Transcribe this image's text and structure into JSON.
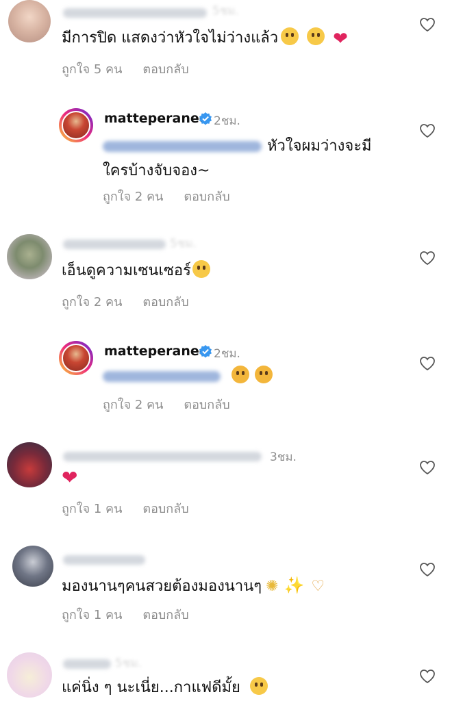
{
  "actions": {
    "like": "ถูกใจ",
    "reply": "ตอบกลับ"
  },
  "comments": [
    {
      "user_label": "nunnnnnnnuch_alt",
      "time": "5ชม.",
      "text": "มีการปิด แสดงว่าหัวใจไม่ว่างแล้ว",
      "emojis": [
        "pleading-face-emoji",
        "crying-face-emoji",
        "red-heart-emoji"
      ],
      "likes": "ถูกใจ 5 คน",
      "reply": "ตอบกลับ"
    },
    {
      "user": "matteperanee",
      "time": "2ชม.",
      "mention_label": "@nunnnnnnnuch_alt",
      "text_line1": "หัวใจผมว่างจะมี",
      "text_line2": "ใครบ้างจับจอง~",
      "likes": "ถูกใจ 2 คน",
      "reply": "ตอบกลับ"
    },
    {
      "user_label": "jarraji.chapnam",
      "time": "5ชม.",
      "text": "เอ็นดูความเซนเซอร์",
      "emojis": [
        "laughing-tears-emoji"
      ],
      "likes": "ถูกใจ 2 คน",
      "reply": "ตอบกลับ"
    },
    {
      "user": "matteperanee",
      "time": "2ชม.",
      "mention_label": "@jarraji.chapnam",
      "emojis": [
        "hand-over-mouth-emoji",
        "hand-over-mouth-emoji"
      ],
      "likes": "ถูกใจ 2 คน",
      "reply": "ตอบกลับ"
    },
    {
      "user_label": "great_prize_brandname_use",
      "time": "3ชม.",
      "emojis": [
        "red-heart-emoji"
      ],
      "likes": "ถูกใจ 1 คน",
      "reply": "ตอบกลับ"
    },
    {
      "user_label": "huaaaaa",
      "text": "มองนานๆคนสวยต้องมองนานๆ",
      "emojis": [
        "dizzy-emoji",
        "sparkles-emoji",
        "heart-hands-emoji"
      ],
      "likes": "ถูกใจ 1 คน",
      "reply": "ตอบกลับ"
    },
    {
      "user_label": "alikaa",
      "time": "5ชม.",
      "text": "แค่นิ่ง ๆ นะเนี่ย...กาแฟดีมั้ย",
      "emojis": [
        "grinning-emoji"
      ]
    }
  ],
  "colors": {
    "text": "#111111",
    "muted": "#8e8e8e",
    "verified": "#3897f0",
    "heart": "#e0245e"
  }
}
